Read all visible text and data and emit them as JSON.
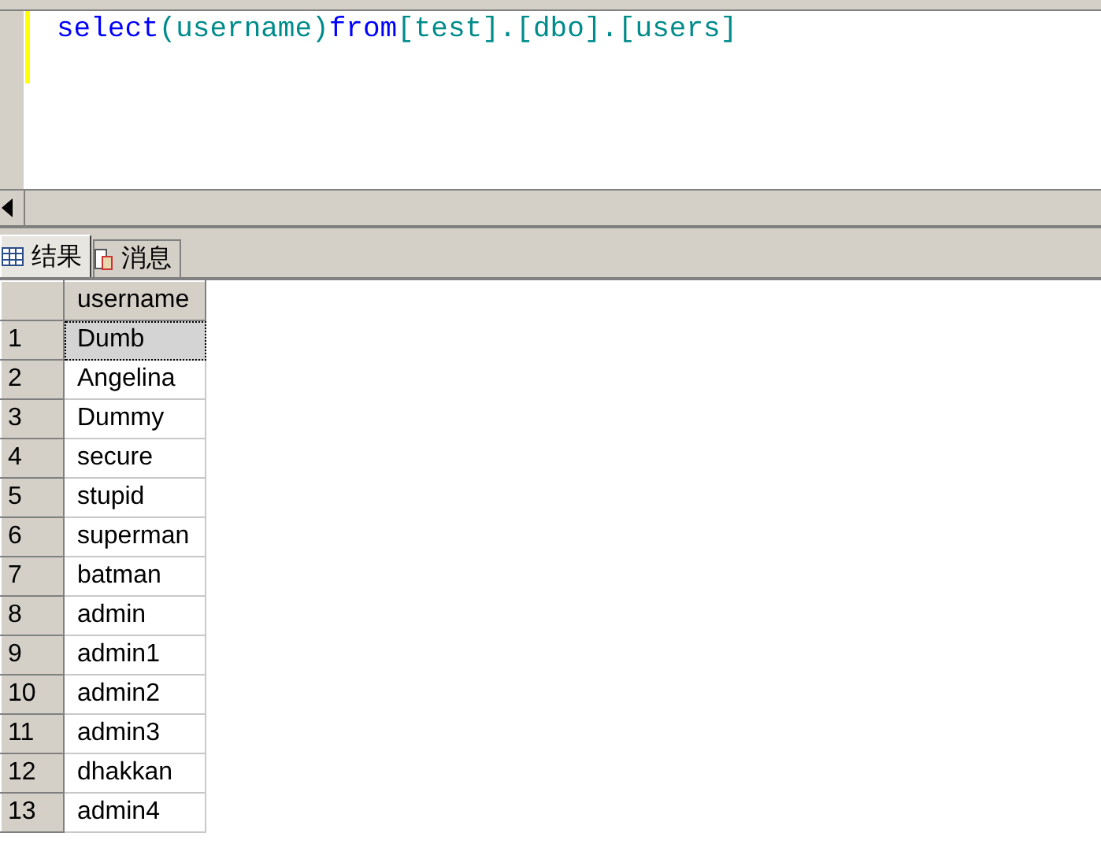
{
  "editor": {
    "code": [
      {
        "kind": "keyword",
        "text": "select"
      },
      {
        "kind": "ident",
        "text": "(username)"
      },
      {
        "kind": "keyword",
        "text": "from"
      },
      {
        "kind": "ident",
        "text": "[test].[dbo].[users]"
      }
    ]
  },
  "result_tabs": [
    {
      "label": "结果",
      "kind": "grid",
      "selected": true
    },
    {
      "label": "消息",
      "kind": "messages",
      "selected": false
    }
  ],
  "grid": {
    "columns": [
      "username"
    ],
    "rows": [
      {
        "num": "1",
        "username": "Dumb",
        "selected": true
      },
      {
        "num": "2",
        "username": "Angelina",
        "selected": false
      },
      {
        "num": "3",
        "username": "Dummy",
        "selected": false
      },
      {
        "num": "4",
        "username": "secure",
        "selected": false
      },
      {
        "num": "5",
        "username": "stupid",
        "selected": false
      },
      {
        "num": "6",
        "username": "superman",
        "selected": false
      },
      {
        "num": "7",
        "username": "batman",
        "selected": false
      },
      {
        "num": "8",
        "username": "admin",
        "selected": false
      },
      {
        "num": "9",
        "username": "admin1",
        "selected": false
      },
      {
        "num": "10",
        "username": "admin2",
        "selected": false
      },
      {
        "num": "11",
        "username": "admin3",
        "selected": false
      },
      {
        "num": "12",
        "username": "dhakkan",
        "selected": false
      },
      {
        "num": "13",
        "username": "admin4",
        "selected": false
      }
    ]
  }
}
